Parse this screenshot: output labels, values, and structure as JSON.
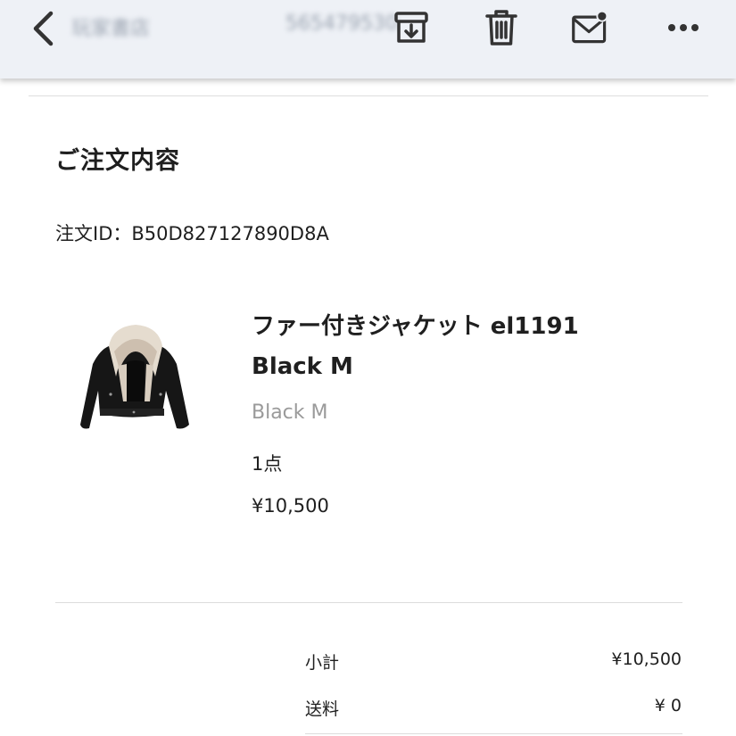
{
  "toolbar": {
    "sender_blurred": "玩家書店",
    "subject_blurred": "565479530"
  },
  "order": {
    "section_title": "ご注文内容",
    "order_id": "注文ID：B50D827127890D8A"
  },
  "product": {
    "name_line1": "ファー付きジャケット el1191",
    "name_line2": "Black M",
    "variant": "Black M",
    "quantity": "1点",
    "price": "¥10,500"
  },
  "summary": {
    "subtotal_label": "小計",
    "subtotal_value": "¥10,500",
    "shipping_label": "送料",
    "shipping_value": "¥ 0"
  },
  "colors": {
    "toolbar_bg": "#eef1f6",
    "icon": "#333333",
    "muted_text": "#9a9a9a"
  }
}
